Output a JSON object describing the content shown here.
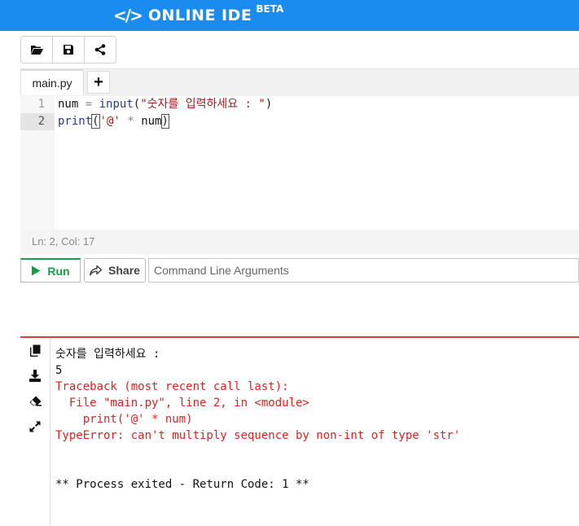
{
  "app": {
    "brand_icon": "</>",
    "brand_name": "ONLINE IDE",
    "brand_badge": "BETA"
  },
  "toolbar": {
    "buttons": [
      {
        "name": "open-folder-icon"
      },
      {
        "name": "save-icon"
      },
      {
        "name": "share-icon"
      }
    ]
  },
  "tabs": {
    "active_label": "main.py",
    "add_label": "+"
  },
  "editor": {
    "line_numbers": [
      "1",
      "2"
    ],
    "active_line": 2,
    "code_lines": [
      "num = input(\"숫자를 입력하세요 : \")",
      "print('@' * num)"
    ]
  },
  "status": {
    "position_text": "Ln: 2,  Col: 17"
  },
  "actions": {
    "run_label": "Run",
    "share_label": "Share",
    "args_placeholder": "Command Line Arguments"
  },
  "output": {
    "lines": [
      {
        "text": "숫자를 입력하세요 :",
        "kind": "normal"
      },
      {
        "text": "5",
        "kind": "normal"
      },
      {
        "text": "Traceback (most recent call last):",
        "kind": "error"
      },
      {
        "text": "  File \"main.py\", line 2, in <module>",
        "kind": "error"
      },
      {
        "text": "    print('@' * num)",
        "kind": "error"
      },
      {
        "text": "TypeError: can't multiply sequence by non-int of type 'str'",
        "kind": "error"
      },
      {
        "text": "",
        "kind": "normal"
      },
      {
        "text": "",
        "kind": "normal"
      },
      {
        "text": "** Process exited - Return Code: 1 **",
        "kind": "normal"
      }
    ]
  },
  "colors": {
    "topbar": "#1a8cf0",
    "run_green": "#1a9b45",
    "error_red": "#dd2222"
  }
}
